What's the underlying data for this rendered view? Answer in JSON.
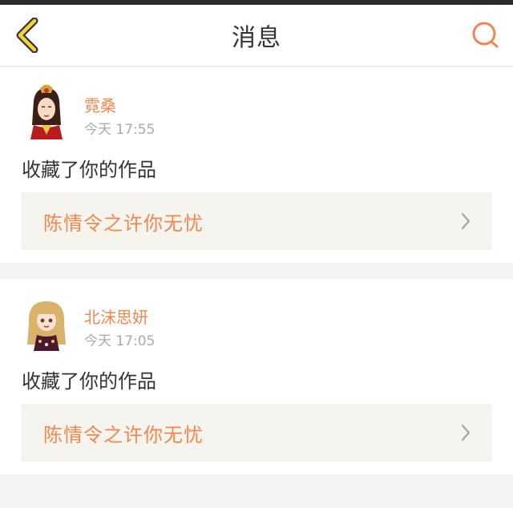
{
  "header": {
    "title": "消息",
    "back_icon": "chevron-left-icon",
    "search_icon": "search-icon",
    "accent_color": "#f0884e"
  },
  "messages": [
    {
      "user": "霓桑",
      "time": "今天 17:55",
      "action": "收藏了你的作品",
      "work_title": "陈情令之许你无忧"
    },
    {
      "user": "北沫思妍",
      "time": "今天 17:05",
      "action": "收藏了你的作品",
      "work_title": "陈情令之许你无忧"
    }
  ]
}
